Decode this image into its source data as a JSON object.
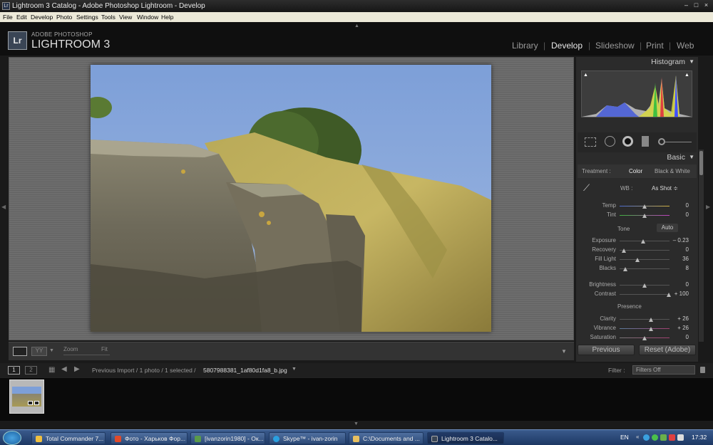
{
  "window": {
    "title": "Lightroom 3 Catalog - Adobe Photoshop Lightroom - Develop"
  },
  "menu": [
    "File",
    "Edit",
    "Develop",
    "Photo",
    "Settings",
    "Tools",
    "View",
    "Window",
    "Help"
  ],
  "header": {
    "brand_small": "ADOBE PHOTOSHOP",
    "brand_large": "LIGHTROOM 3",
    "logo": "Lr"
  },
  "modules": [
    "Library",
    "Develop",
    "Slideshow",
    "Print",
    "Web"
  ],
  "active_module": "Develop",
  "toolbar": {
    "zoom_label": "Zoom",
    "zoom_value": "Fit"
  },
  "panels": {
    "histogram_title": "Histogram",
    "basic_title": "Basic",
    "treatment_label": "Treatment :",
    "treatment_options": [
      "Color",
      "Black & White"
    ],
    "wb_label": "WB :",
    "wb_value": "As Shot ≑",
    "tone_label": "Tone",
    "auto_label": "Auto",
    "presence_label": "Presence",
    "sliders": [
      {
        "label": "Temp",
        "value": "0",
        "pos": 0.5
      },
      {
        "label": "Tint",
        "value": "0",
        "pos": 0.5
      },
      {
        "label": "Exposure",
        "value": "– 0.23",
        "pos": 0.47
      },
      {
        "label": "Recovery",
        "value": "0",
        "pos": 0.08
      },
      {
        "label": "Fill Light",
        "value": "36",
        "pos": 0.36
      },
      {
        "label": "Blacks",
        "value": "8",
        "pos": 0.12
      },
      {
        "label": "Brightness",
        "value": "0",
        "pos": 0.5
      },
      {
        "label": "Contrast",
        "value": "+ 100",
        "pos": 0.98
      },
      {
        "label": "Clarity",
        "value": "+ 26",
        "pos": 0.63
      },
      {
        "label": "Vibrance",
        "value": "+ 26",
        "pos": 0.63
      },
      {
        "label": "Saturation",
        "value": "0",
        "pos": 0.5
      }
    ],
    "previous_label": "Previous",
    "reset_label": "Reset (Adobe)"
  },
  "filmbar": {
    "page1": "1",
    "page2": "2",
    "path": "Previous Import / 1 photo / 1 selected /",
    "filename": "5807988381_1af80d1fa8_b.jpg",
    "filter_label": "Filter :",
    "filter_value": "Filters Off"
  },
  "taskbar": {
    "tasks": [
      "Total Commander 7...",
      "Фото - Харьков Фор...",
      "[ivanzorin1980] - Ок...",
      "Skype™ - ivan-zorin",
      "C:\\Documents and ...",
      "Lightroom 3 Catalo..."
    ],
    "lang": "EN",
    "clock": "17:32"
  }
}
